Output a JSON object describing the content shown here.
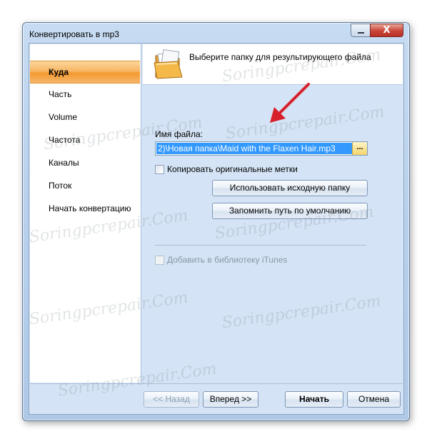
{
  "window": {
    "title": "Конвертировать в mp3",
    "close_glyph": "X"
  },
  "sidebar": {
    "items": [
      {
        "label": "Куда",
        "active": true
      },
      {
        "label": "Часть"
      },
      {
        "label": "Volume"
      },
      {
        "label": "Частота"
      },
      {
        "label": "Каналы"
      },
      {
        "label": "Поток"
      },
      {
        "label": "Начать конвертацию"
      }
    ]
  },
  "header": {
    "icon": "folder-icon",
    "text": "Выберите папку для результирующего файла"
  },
  "form": {
    "file_label": "Имя файла:",
    "file_value": "2)\\Новая папка\\Maid with the Flaxen Hair.mp3",
    "browse_label": "...",
    "copy_tags_label": "Копировать оригинальные метки",
    "copy_tags_checked": false,
    "use_source_folder_label": "Использовать исходную папку",
    "remember_path_label": "Запомнить путь по умолчанию",
    "itunes_label": "Добавить в библиотеку iTunes",
    "itunes_checked": false,
    "itunes_enabled": false
  },
  "footer": {
    "back_label": "<< Назад",
    "next_label": "Вперед >>",
    "start_label": "Начать",
    "cancel_label": "Отмена"
  },
  "watermark": "Soringpcrepair.Com",
  "colors": {
    "active_item": "#f49a2f",
    "selection": "#3399ff",
    "arrow": "#d8202a"
  }
}
